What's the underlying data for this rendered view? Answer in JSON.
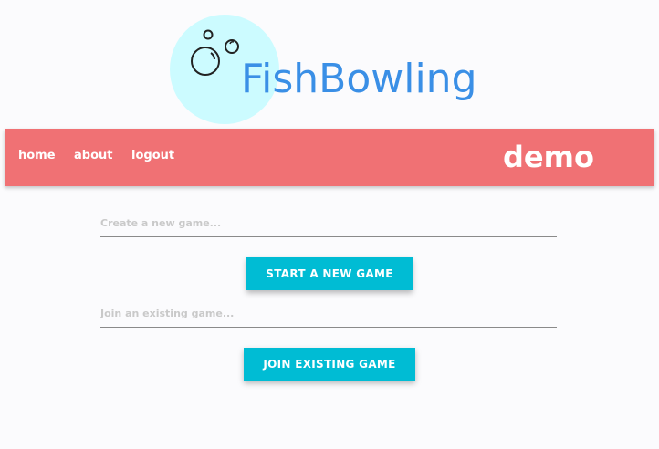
{
  "logo": {
    "text": "FishBowling",
    "circle_color": "#ccfbff",
    "text_color": "#3a8fe6",
    "icon": "bubbles-icon"
  },
  "navbar": {
    "background": "#f07174",
    "links": [
      {
        "label": "home"
      },
      {
        "label": "about"
      },
      {
        "label": "logout"
      }
    ],
    "brand": "demo"
  },
  "create_game": {
    "placeholder": "Create a new game...",
    "value": "",
    "button_label": "START A NEW GAME"
  },
  "join_game": {
    "placeholder": "Join an existing game...",
    "value": "",
    "button_label": "JOIN EXISTING GAME"
  },
  "colors": {
    "accent_button": "#00bcd4"
  }
}
